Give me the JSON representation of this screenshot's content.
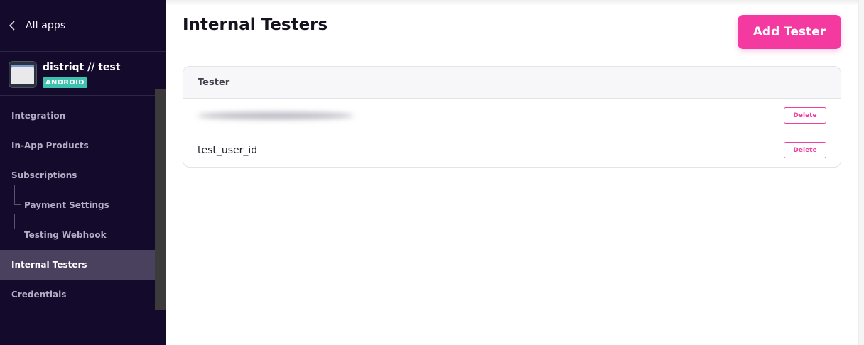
{
  "sidebar": {
    "back_label": "All apps",
    "app": {
      "name": "distriqt // test",
      "platform": "ANDROID"
    },
    "items": [
      {
        "label": "Integration"
      },
      {
        "label": "In-App Products"
      },
      {
        "label": "Subscriptions"
      },
      {
        "label": "Payment Settings"
      },
      {
        "label": "Testing Webhook"
      },
      {
        "label": "Internal Testers"
      },
      {
        "label": "Credentials"
      }
    ],
    "active_item": "Internal Testers"
  },
  "main": {
    "title": "Internal Testers",
    "add_button_label": "Add Tester",
    "table": {
      "column_header": "Tester",
      "rows": [
        {
          "tester": "",
          "redacted": true,
          "action_label": "Delete"
        },
        {
          "tester": "test_user_id",
          "redacted": false,
          "action_label": "Delete"
        }
      ]
    }
  },
  "colors": {
    "sidebar_bg": "#140a2c",
    "accent_pink": "#f43aa0",
    "badge_teal": "#3ec2b0",
    "active_item_bg": "#4a415f"
  },
  "icons": {
    "back": "chevron-left-icon",
    "app": "app-window-icon"
  }
}
